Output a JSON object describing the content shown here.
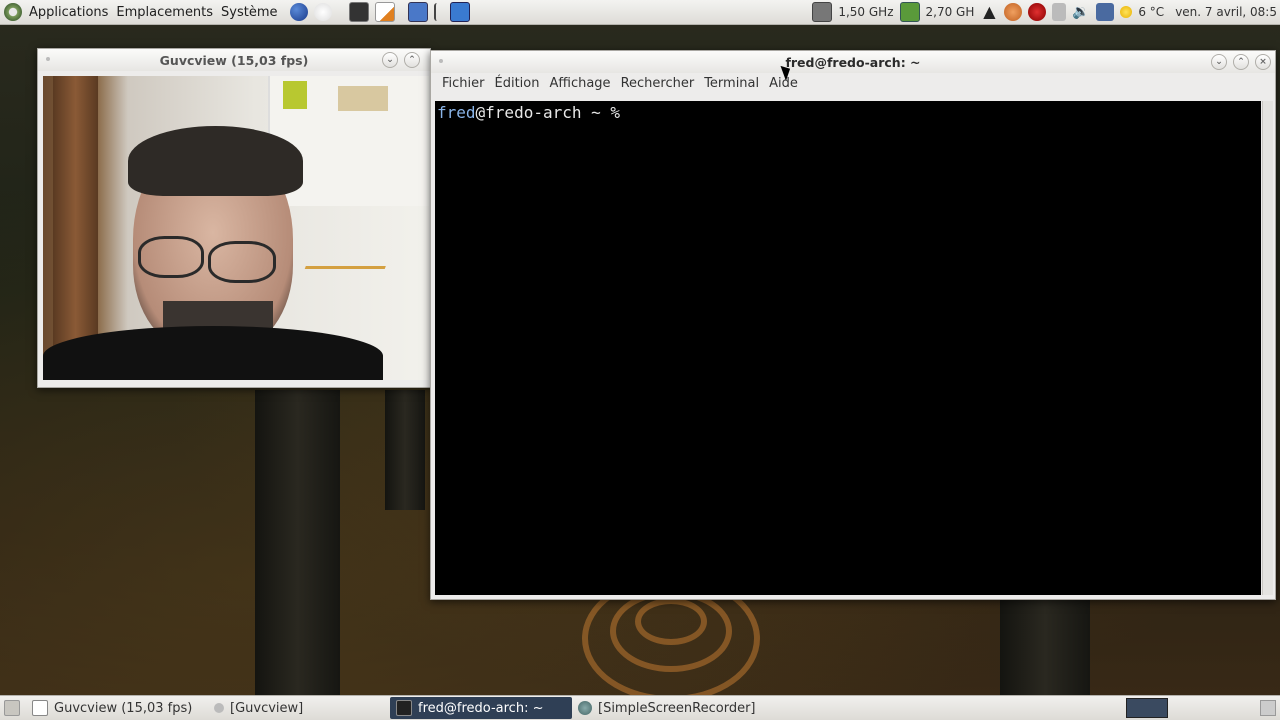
{
  "top_panel": {
    "menus": [
      "Applications",
      "Emplacements",
      "Système"
    ],
    "cpu1": "1,50 GHz",
    "cpu2": "2,70 GH",
    "weather": "6 °C",
    "clock": "ven.  7 avril, 08:5"
  },
  "guvcview_window": {
    "title": "Guvcview  (15,03 fps)"
  },
  "terminal_window": {
    "title": "fred@fredo-arch: ~",
    "menu": [
      "Fichier",
      "Édition",
      "Affichage",
      "Rechercher",
      "Terminal",
      "Aide"
    ],
    "prompt_user": "fred",
    "prompt_rest": "@fredo-arch ~ %"
  },
  "taskbar": {
    "items": [
      "Guvcview  (15,03 fps)",
      "[Guvcview]",
      "fred@fredo-arch: ~",
      "[SimpleScreenRecorder]"
    ]
  },
  "colors": {
    "active_task": "#2f3f55",
    "prompt_user": "#8ab4e8",
    "terminal_bg": "#000000"
  },
  "icons": [
    "distro-logo-icon",
    "globe-icon",
    "terminal-launcher-icon",
    "text-editor-icon",
    "cpu-icon",
    "weather-icon",
    "volume-icon",
    "network-icon"
  ]
}
